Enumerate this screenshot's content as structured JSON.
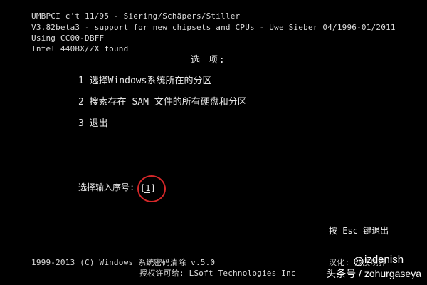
{
  "header": {
    "line1": "UMBPCI c't 11/95 - Siering/Schäpers/Stiller",
    "line2": "V3.82beta3 - support for new chipsets and CPUs - Uwe Sieber 04/1996-01/2011",
    "line3": "Using CC00-DBFF",
    "line4": "Intel 440BX/ZX found"
  },
  "menu": {
    "title": "选  项:",
    "items": [
      {
        "number": "1",
        "label": "选择Windows系统所在的分区"
      },
      {
        "number": "2",
        "label": "搜索存在 SAM 文件的所有硬盘和分区"
      },
      {
        "number": "3",
        "label": "退出"
      }
    ]
  },
  "prompt": {
    "label": "选择输入序号:",
    "value": "[1]"
  },
  "hint": "按 Esc 键退出",
  "footer": {
    "copyright": "1999-2013 (C)  Windows 系统密码清除 v.5.0",
    "license": "授权许可给: LSoft Technologies Inc",
    "localize": "汉化: 沙漠境界"
  },
  "watermark": {
    "id": "izdenish",
    "source": "头条号 / zohurgaseya"
  },
  "colors": {
    "background": "#000000",
    "text": "#dcdcdc",
    "annotation_circle": "#d7282a"
  }
}
